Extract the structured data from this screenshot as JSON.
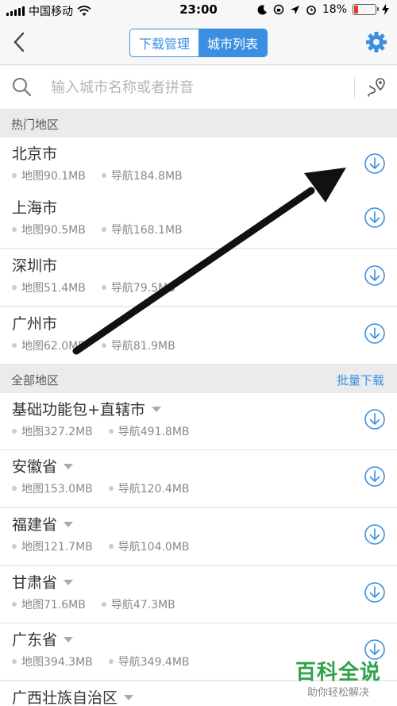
{
  "status_bar": {
    "carrier": "中国移动",
    "time": "23:00",
    "battery": "18%",
    "battery_level": 0.18
  },
  "nav": {
    "tabs": [
      {
        "label": "下载管理",
        "active": false
      },
      {
        "label": "城市列表",
        "active": true
      }
    ]
  },
  "search": {
    "placeholder": "输入城市名称或者拼音",
    "value": ""
  },
  "hot_section": {
    "title": "热门地区",
    "items": [
      {
        "name": "北京市",
        "map_size": "地图90.1MB",
        "nav_size": "导航184.8MB"
      },
      {
        "name": "上海市",
        "map_size": "地图90.5MB",
        "nav_size": "导航168.1MB"
      },
      {
        "name": "深圳市",
        "map_size": "地图51.4MB",
        "nav_size": "导航79.5MB"
      },
      {
        "name": "广州市",
        "map_size": "地图62.0MB",
        "nav_size": "导航81.9MB"
      }
    ]
  },
  "all_section": {
    "title": "全部地区",
    "action": "批量下载",
    "items": [
      {
        "name": "基础功能包+直辖市",
        "map_size": "地图327.2MB",
        "nav_size": "导航491.8MB"
      },
      {
        "name": "安徽省",
        "map_size": "地图153.0MB",
        "nav_size": "导航120.4MB"
      },
      {
        "name": "福建省",
        "map_size": "地图121.7MB",
        "nav_size": "导航104.0MB"
      },
      {
        "name": "甘肃省",
        "map_size": "地图71.6MB",
        "nav_size": "导航47.3MB"
      },
      {
        "name": "广东省",
        "map_size": "地图394.3MB",
        "nav_size": "导航349.4MB"
      },
      {
        "name": "广西壮族自治区",
        "map_size": "",
        "nav_size": ""
      }
    ]
  },
  "watermark": {
    "main": "百科全说",
    "sub": "助你轻松解决"
  },
  "colors": {
    "accent": "#3b8fe0",
    "watermark_green": "#2fa34a"
  }
}
